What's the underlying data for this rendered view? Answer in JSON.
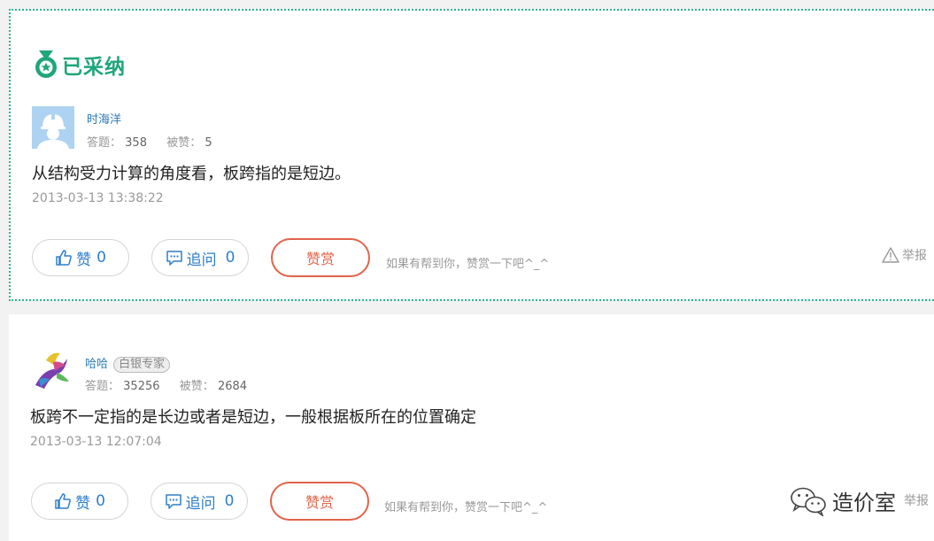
{
  "answers": [
    {
      "accepted_badge": "已采纳",
      "user_name": "时海洋",
      "expert_tag": "",
      "answers_label": "答题：",
      "answers_count": "358",
      "likes_label": "被赞：",
      "likes_count": "5",
      "content": "从结构受力计算的角度看，板跨指的是短边。",
      "timestamp": "2013-03-13 13:38:22",
      "like_label": "赞",
      "like_count": "0",
      "followup_label": "追问",
      "followup_count": "0",
      "reward_label": "赞赏",
      "reward_hint": "如果有帮到你，赞赏一下吧^_^",
      "report_label": "举报"
    },
    {
      "accepted_badge": "",
      "user_name": "哈哈",
      "expert_tag": "白银专家",
      "answers_label": "答题：",
      "answers_count": "35256",
      "likes_label": "被赞：",
      "likes_count": "2684",
      "content": "板跨不一定指的是长边或者是短边，一般根据板所在的位置确定",
      "timestamp": "2013-03-13 12:07:04",
      "like_label": "赞",
      "like_count": "0",
      "followup_label": "追问",
      "followup_count": "0",
      "reward_label": "赞赏",
      "reward_hint": "如果有帮到你，赞赏一下吧^_^",
      "report_label": "举报"
    }
  ],
  "watermark": "造价室",
  "colors": {
    "accent_green": "#1fa67a",
    "link_blue": "#2f7fc9",
    "reward_red": "#e0644a"
  }
}
